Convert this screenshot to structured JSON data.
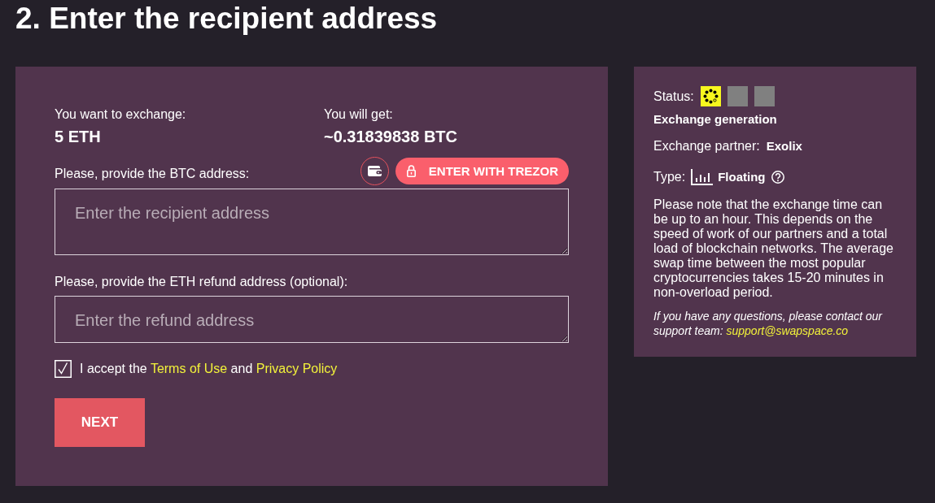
{
  "title": "2. Enter the recipient address",
  "exchange": {
    "send": {
      "label": "You want to exchange:",
      "value": "5 ETH"
    },
    "receive": {
      "label": "You will get:",
      "value": "~0.31839838 BTC"
    }
  },
  "recipient": {
    "label": "Please, provide the BTC address:",
    "placeholder": "Enter the recipient address",
    "trezor_button": "ENTER WITH TREZOR"
  },
  "refund": {
    "label": "Please, provide the ETH refund address (optional):",
    "placeholder": "Enter the refund address"
  },
  "terms": {
    "checked": true,
    "text_before": "I accept the",
    "link_1": "Terms of Use",
    "text_between": "and",
    "link_2": "Privacy Policy"
  },
  "next_button": "NEXT",
  "sidebar": {
    "status_label": "Status:",
    "steps": [
      {
        "active": true
      },
      {
        "active": false
      },
      {
        "active": false
      }
    ],
    "status_text": "Exchange generation",
    "partner_label": "Exchange partner:",
    "partner": "Exolix",
    "type_label": "Type:",
    "type": "Floating",
    "note": "Please note that the exchange time can be up to an hour. This depends on the speed of work of our partners and a total load of blockchain networks. The average swap time between the most popular cryptocurrencies takes 15-20 minutes in non-overload period.",
    "contact": "If you have any questions, please contact our support team:",
    "email": "support@swapspace.co"
  }
}
